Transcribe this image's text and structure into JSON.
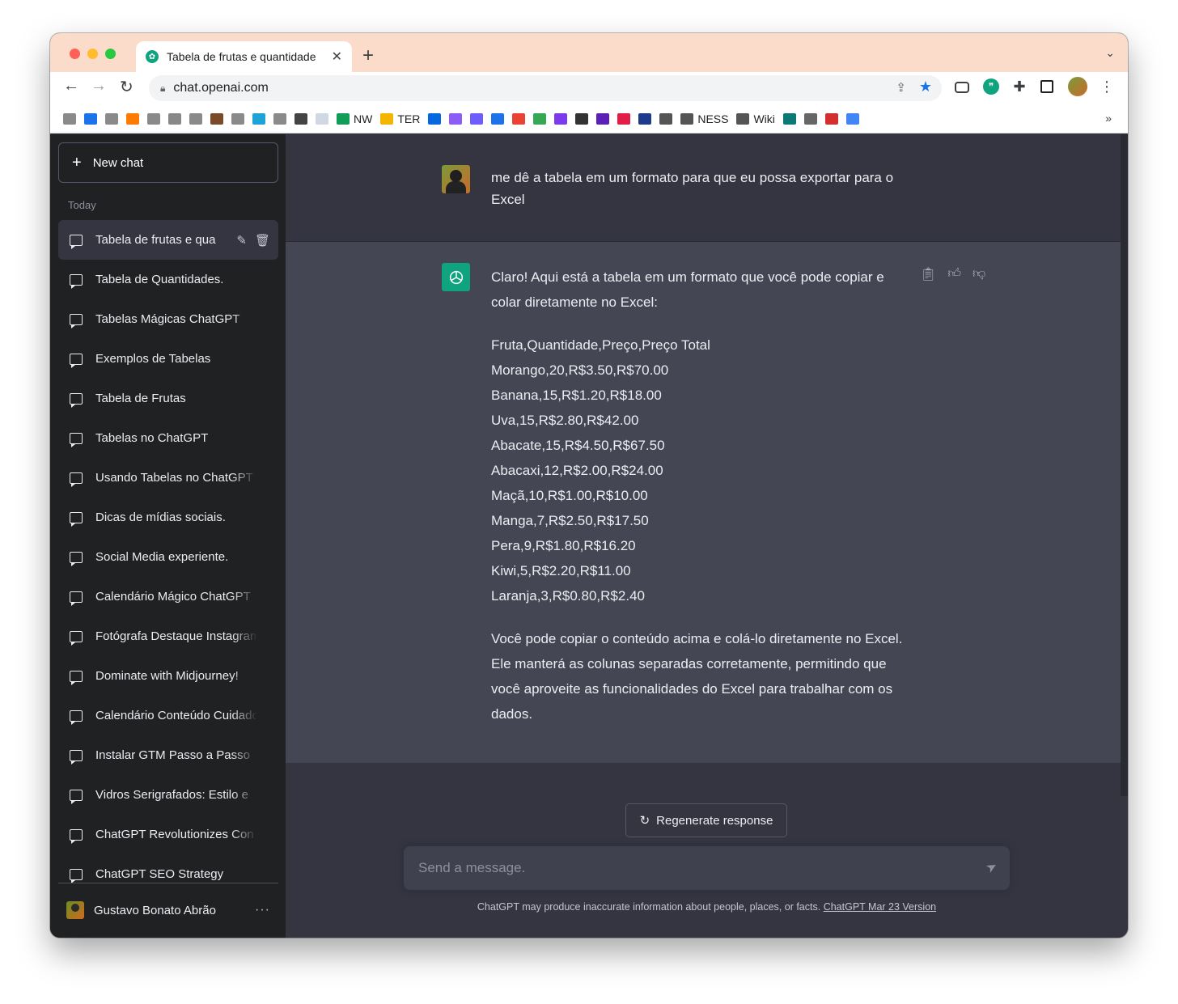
{
  "browser": {
    "tab_title": "Tabela de frutas e quantidade",
    "url": "chat.openai.com",
    "bookmarks": [
      {
        "label": "",
        "color": "#8a8a8a"
      },
      {
        "label": "",
        "color": "#1a73e8"
      },
      {
        "label": "",
        "color": "#8a8a8a"
      },
      {
        "label": "",
        "color": "#ff7a00"
      },
      {
        "label": "",
        "color": "#8a8a8a"
      },
      {
        "label": "",
        "color": "#888888"
      },
      {
        "label": "",
        "color": "#8a8a8a"
      },
      {
        "label": "",
        "color": "#7a4a2a"
      },
      {
        "label": "",
        "color": "#8a8a8a"
      },
      {
        "label": "",
        "color": "#1fa2d6"
      },
      {
        "label": "",
        "color": "#8a8a8a"
      },
      {
        "label": "",
        "color": "#444444"
      },
      {
        "label": "",
        "color": "#cfd8e3"
      },
      {
        "label": "NW",
        "color": "#0f9d58"
      },
      {
        "label": "TER",
        "color": "#f4b400"
      },
      {
        "label": "",
        "color": "#0668e1"
      },
      {
        "label": "",
        "color": "#8b5cf6"
      },
      {
        "label": "",
        "color": "#6d5dfc"
      },
      {
        "label": "",
        "color": "#1a73e8"
      },
      {
        "label": "",
        "color": "#ea4335"
      },
      {
        "label": "",
        "color": "#34a853"
      },
      {
        "label": "",
        "color": "#7c3aed"
      },
      {
        "label": "",
        "color": "#333333"
      },
      {
        "label": "",
        "color": "#5b21b6"
      },
      {
        "label": "",
        "color": "#e11d48"
      },
      {
        "label": "",
        "color": "#1e3a8a"
      },
      {
        "label": "",
        "color": "#555555"
      },
      {
        "label": "NESS",
        "color": "#555555"
      },
      {
        "label": "Wiki",
        "color": "#555555"
      },
      {
        "label": "",
        "color": "#0b7a75"
      },
      {
        "label": "",
        "color": "#666666"
      },
      {
        "label": "",
        "color": "#d32f2f"
      },
      {
        "label": "",
        "color": "#4285f4"
      }
    ],
    "more_bookmarks": "»"
  },
  "sidebar": {
    "new_chat_label": "New chat",
    "section_today": "Today",
    "conversations": [
      "Tabela de frutas e qua",
      "Tabela de Quantidades.",
      "Tabelas Mágicas ChatGPT",
      "Exemplos de Tabelas",
      "Tabela de Frutas",
      "Tabelas no ChatGPT",
      "Usando Tabelas no ChatGPT",
      "Dicas de mídias sociais.",
      "Social Media experiente.",
      "Calendário Mágico ChatGPT",
      "Fotógrafa Destaque Instagram",
      "Dominate with Midjourney!",
      "Calendário Conteúdo Cuidado",
      "Instalar GTM Passo a Passo",
      "Vidros Serigrafados: Estilo e",
      "ChatGPT Revolutionizes Con",
      "ChatGPT SEO Strategy"
    ],
    "user_name": "Gustavo Bonato Abrão",
    "user_menu": "···"
  },
  "chat": {
    "user_message": "me dê a tabela em um formato para que eu possa exportar para o Excel",
    "assistant_intro": "Claro! Aqui está a tabela em um formato que você pode copiar e colar diretamente no Excel:",
    "csv_lines": [
      "Fruta,Quantidade,Preço,Preço Total",
      "Morango,20,R$3.50,R$70.00",
      "Banana,15,R$1.20,R$18.00",
      "Uva,15,R$2.80,R$42.00",
      "Abacate,15,R$4.50,R$67.50",
      "Abacaxi,12,R$2.00,R$24.00",
      "Maçã,10,R$1.00,R$10.00",
      "Manga,7,R$2.50,R$17.50",
      "Pera,9,R$1.80,R$16.20",
      "Kiwi,5,R$2.20,R$11.00",
      "Laranja,3,R$0.80,R$2.40"
    ],
    "assistant_outro": "Você pode copiar o conteúdo acima e colá-lo diretamente no Excel. Ele manterá as colunas separadas corretamente, permitindo que você aproveite as funcionalidades do Excel para trabalhar com os dados.",
    "regenerate_label": "Regenerate response",
    "input_placeholder": "Send a message.",
    "disclaimer": "ChatGPT may produce inaccurate information about people, places, or facts.",
    "version_link": "ChatGPT Mar 23 Version"
  },
  "colors": {
    "sidebar_bg": "#202123",
    "main_bg": "#343541",
    "assistant_bg": "#444654",
    "accent": "#10a37f"
  }
}
